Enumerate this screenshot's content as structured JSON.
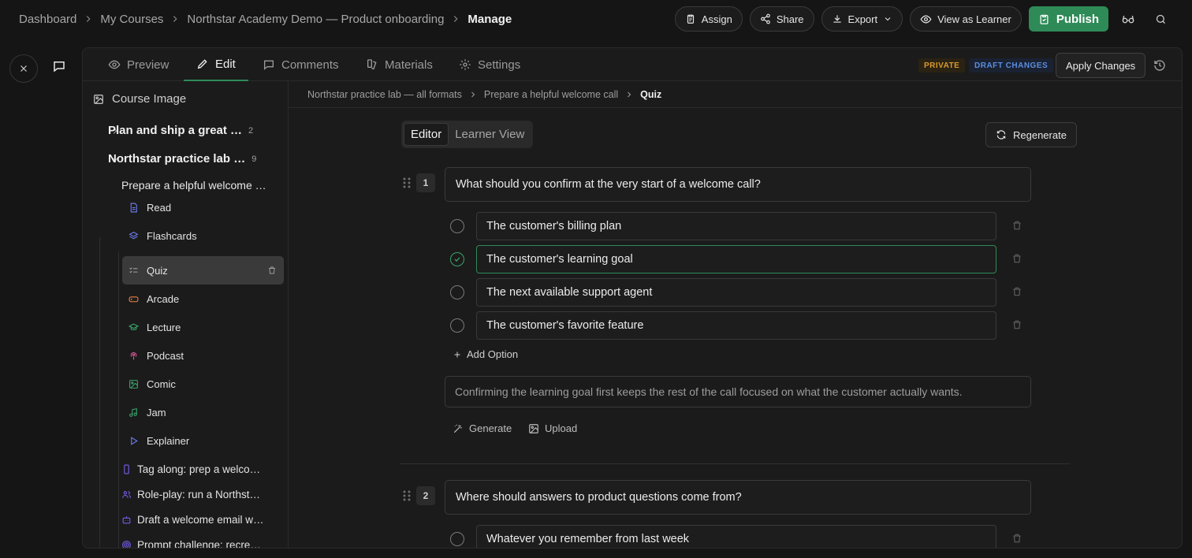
{
  "breadcrumb": {
    "items": [
      "Dashboard",
      "My Courses",
      "Northstar Academy Demo — Product onboarding"
    ],
    "current": "Manage"
  },
  "top_actions": {
    "assign": "Assign",
    "share": "Share",
    "export": "Export",
    "view_as_learner": "View as Learner",
    "publish": "Publish"
  },
  "tabs": [
    "Preview",
    "Edit",
    "Comments",
    "Materials",
    "Settings"
  ],
  "active_tab": "Edit",
  "status": {
    "private": "PRIVATE",
    "draft": "DRAFT CHANGES"
  },
  "apply_label": "Apply Changes",
  "sidebar": {
    "course_image": "Course Image",
    "groups": [
      {
        "label": "Plan and ship a great …",
        "count": "2"
      },
      {
        "label": "Northstar practice lab …",
        "count": "9"
      }
    ],
    "sub_title": "Prepare a helpful welcome …",
    "items": [
      {
        "label": "Read",
        "icon": "document-icon",
        "color": "#6d7ff0"
      },
      {
        "label": "Flashcards",
        "icon": "layers-icon",
        "color": "#6d7ff0"
      },
      {
        "label": "Quiz",
        "icon": "list-check-icon",
        "color": "#9aa0a6"
      },
      {
        "label": "Arcade",
        "icon": "gamepad-icon",
        "color": "#e8834a"
      },
      {
        "label": "Lecture",
        "icon": "graduation-cap-icon",
        "color": "#3aa36a"
      },
      {
        "label": "Podcast",
        "icon": "podcast-icon",
        "color": "#e05a9c"
      },
      {
        "label": "Comic",
        "icon": "image-icon",
        "color": "#3aa36a"
      },
      {
        "label": "Jam",
        "icon": "music-icon",
        "color": "#3aa36a"
      },
      {
        "label": "Explainer",
        "icon": "play-icon",
        "color": "#6d7ff0"
      }
    ],
    "extras": [
      {
        "label": "Tag along: prep a welco…",
        "icon": "phone-icon",
        "color": "#7a5cf0"
      },
      {
        "label": "Role-play: run a Northst…",
        "icon": "users-icon",
        "color": "#7a5cf0"
      },
      {
        "label": "Draft a welcome email w…",
        "icon": "bot-icon",
        "color": "#7a5cf0"
      },
      {
        "label": "Prompt challenge: recre…",
        "icon": "target-icon",
        "color": "#7a5cf0"
      }
    ]
  },
  "content_breadcrumb": {
    "items": [
      "Northstar practice lab — all formats",
      "Prepare a helpful welcome call"
    ],
    "current": "Quiz"
  },
  "view_toggle": {
    "editor": "Editor",
    "learner": "Learner View"
  },
  "regenerate": "Regenerate",
  "questions": [
    {
      "number": "1",
      "text": "What should you confirm at the very start of a welcome call?",
      "options": [
        {
          "text": "The customer's billing plan",
          "correct": false
        },
        {
          "text": "The customer's learning goal",
          "correct": true
        },
        {
          "text": "The next available support agent",
          "correct": false
        },
        {
          "text": "The customer's favorite feature",
          "correct": false
        }
      ],
      "add_option": "Add Option",
      "explanation": "Confirming the learning goal first keeps the rest of the call focused on what the customer actually wants.",
      "generate": "Generate",
      "upload": "Upload"
    },
    {
      "number": "2",
      "text": "Where should answers to product questions come from?",
      "options": [
        {
          "text": "Whatever you remember from last week",
          "correct": false
        }
      ]
    }
  ]
}
